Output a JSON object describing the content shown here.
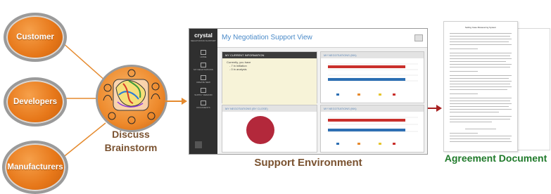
{
  "stakeholders": [
    {
      "label": "Customer"
    },
    {
      "label": "Developers"
    },
    {
      "label": "Manufacturers"
    }
  ],
  "brainstorm": {
    "line1": "Discuss",
    "line2": "Brainstorm"
  },
  "app": {
    "logo": "crystal",
    "logo_sub": "NEGOTIATION SUPPORT",
    "title": "My Negotiation Support View",
    "nav": [
      "HOME",
      "MY NEGOTIATIONS",
      "CREATE NEW",
      "SUPPLY DEMAND",
      "DOCUMENTS"
    ],
    "panels": {
      "current_info": {
        "title": "MY CURRENT INFORMATION",
        "lines": [
          "Currently, you have",
          "- 7 in  initiation",
          "- 0 in  analysis"
        ]
      },
      "neg_a": {
        "title": "MY NEGOTIATIONS  (NN)"
      },
      "neg_b": {
        "title": "MY NEGOTIATIONS  (BY CLOSE)"
      },
      "neg_c": {
        "title": "MY NEGOTIATIONS  (NN)"
      }
    },
    "legend": [
      "Preparation Phase",
      "Under Negotiation",
      "Ready",
      "Closed"
    ],
    "colors": {
      "blue": "#2d6fb3",
      "orange": "#e68a2e",
      "yellow": "#e6c52e",
      "red": "#c9302c",
      "pie": "#b3283b"
    }
  },
  "support_label": "Support  Environment",
  "agreement_label": "Agreement Document",
  "document": {
    "heading": "Selling Case Manavering System"
  }
}
